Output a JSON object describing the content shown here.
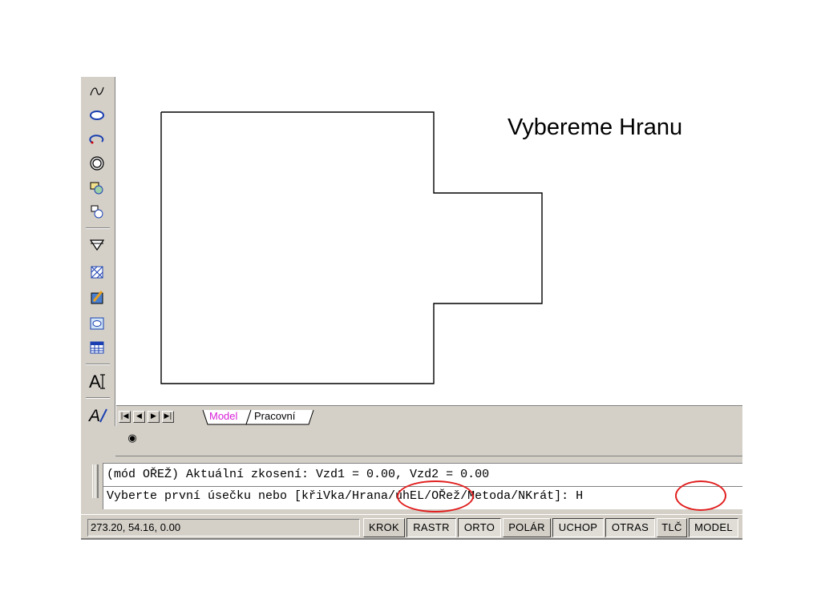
{
  "caption": "Vybereme Hranu",
  "toolbar": {
    "tools": [
      "spline-icon",
      "ellipse-icon",
      "ellipse-arc-icon",
      "donut-icon",
      "insert-block-icon",
      "make-block-icon",
      "point-icon",
      "hatch-icon",
      "gradient-icon",
      "region-icon",
      "table-icon",
      "multiline-text-icon",
      "edit-text-icon"
    ]
  },
  "tabs": {
    "model": "Model",
    "pracovni": "Pracovní"
  },
  "command": {
    "line1": "(mód OŘEŽ) Aktuální zkosení: Vzd1 = 0.00, Vzd2 = 0.00",
    "line2": "Vyberte první úsečku nebo [křiVka/Hrana/úhEL/OŘež/Metoda/NKrát]: H"
  },
  "status": {
    "coords": "273.20, 54.16, 0.00",
    "buttons": [
      {
        "label": "KROK",
        "pressed": false
      },
      {
        "label": "RASTR",
        "pressed": true
      },
      {
        "label": "ORTO",
        "pressed": true
      },
      {
        "label": "POLÁR",
        "pressed": false
      },
      {
        "label": "UCHOP",
        "pressed": true
      },
      {
        "label": "OTRAS",
        "pressed": true
      },
      {
        "label": "TLČ",
        "pressed": false
      },
      {
        "label": "MODEL",
        "pressed": true
      }
    ]
  },
  "highlight_color": "#e11f1f"
}
